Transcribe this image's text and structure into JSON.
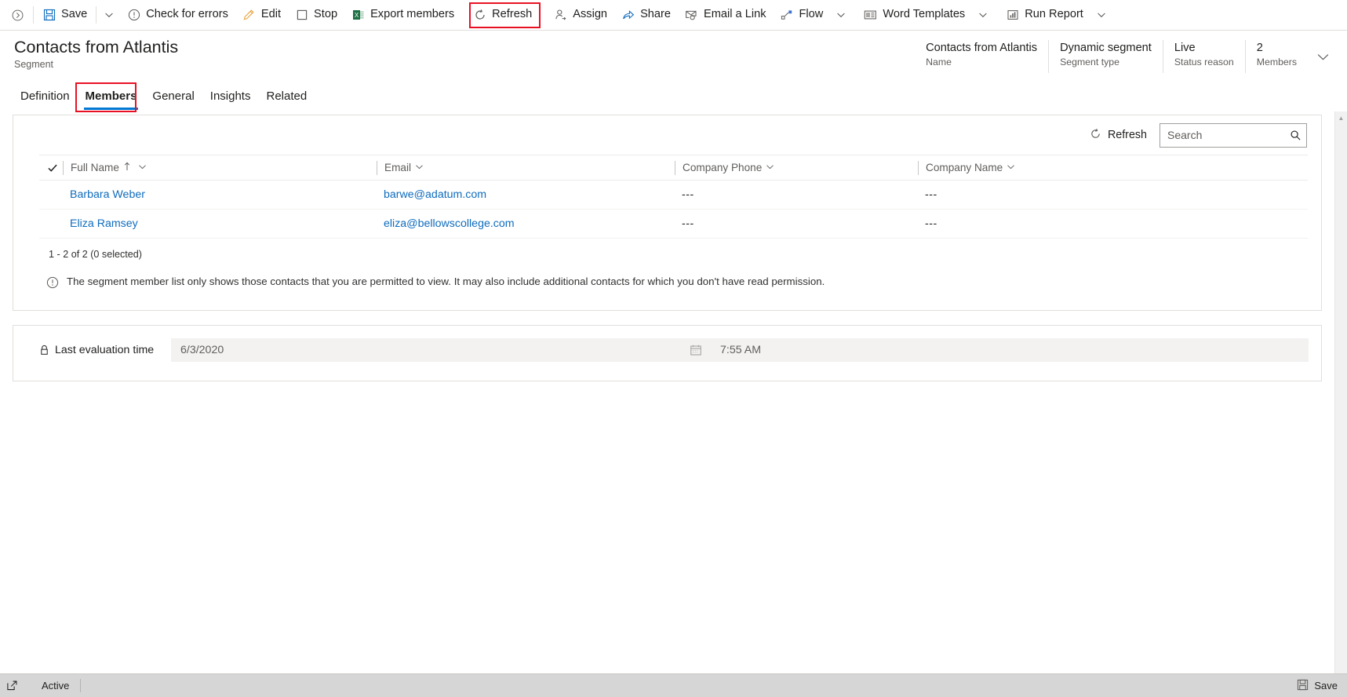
{
  "commandbar": {
    "expand_icon": "expand-right-icon",
    "buttons": [
      {
        "label": "Save",
        "icon": "save-icon",
        "chevron": true
      },
      {
        "label": "Check for errors",
        "icon": "error-circle-icon",
        "chevron": false
      },
      {
        "label": "Edit",
        "icon": "pencil-icon",
        "chevron": false
      },
      {
        "label": "Stop",
        "icon": "stop-square-icon",
        "chevron": false
      },
      {
        "label": "Export members",
        "icon": "excel-icon",
        "chevron": false
      },
      {
        "label": "Refresh",
        "icon": "refresh-icon",
        "chevron": false,
        "highlighted": true
      },
      {
        "label": "Assign",
        "icon": "assign-person-icon",
        "chevron": false
      },
      {
        "label": "Share",
        "icon": "share-icon",
        "chevron": false
      },
      {
        "label": "Email a Link",
        "icon": "email-link-icon",
        "chevron": false
      },
      {
        "label": "Flow",
        "icon": "flow-icon",
        "chevron": true
      },
      {
        "label": "Word Templates",
        "icon": "word-template-icon",
        "chevron": true
      },
      {
        "label": "Run Report",
        "icon": "run-report-icon",
        "chevron": true
      }
    ]
  },
  "header": {
    "title": "Contacts from Atlantis",
    "subtitle": "Segment",
    "fields": [
      {
        "value": "Contacts from Atlantis",
        "label": "Name"
      },
      {
        "value": "Dynamic segment",
        "label": "Segment type"
      },
      {
        "value": "Live",
        "label": "Status reason"
      },
      {
        "value": "2",
        "label": "Members"
      }
    ],
    "collapse_icon": "chevron-down-icon"
  },
  "tabs": [
    {
      "label": "Definition",
      "active": false
    },
    {
      "label": "Members",
      "active": true,
      "highlighted": true
    },
    {
      "label": "General",
      "active": false
    },
    {
      "label": "Insights",
      "active": false
    },
    {
      "label": "Related",
      "active": false
    }
  ],
  "grid": {
    "refresh_label": "Refresh",
    "refresh_icon": "refresh-icon",
    "search_placeholder": "Search",
    "search_value": "",
    "search_icon": "magnifier-icon",
    "select_all_icon": "checkmark-icon",
    "columns": [
      {
        "label": "Full Name",
        "sorted": true,
        "sort_icon": "sort-ascending-icon"
      },
      {
        "label": "Email",
        "sorted": false
      },
      {
        "label": "Company Phone",
        "sorted": false
      },
      {
        "label": "Company Name",
        "sorted": false
      }
    ],
    "rows": [
      {
        "full_name": "Barbara Weber",
        "email": "barwe@adatum.com",
        "company_phone": "---",
        "company_name": "---"
      },
      {
        "full_name": "Eliza Ramsey",
        "email": "eliza@bellowscollege.com",
        "company_phone": "---",
        "company_name": "---"
      }
    ],
    "footer_count": "1 - 2 of 2 (0 selected)",
    "notice_icon": "info-circle-icon",
    "notice": "The segment member list only shows those contacts that you are permitted to view. It may also include additional contacts for which you don't have read permission."
  },
  "evaluation": {
    "lock_icon": "lock-icon",
    "label": "Last evaluation time",
    "date_value": "6/3/2020",
    "calendar_icon": "calendar-icon",
    "time_value": "7:55 AM"
  },
  "footer": {
    "popout_icon": "popout-icon",
    "status": "Active",
    "save_label": "Save",
    "save_icon": "save-icon"
  },
  "colors": {
    "accent": "#0078d4",
    "link": "#0f6cbd",
    "highlight": "#e81123",
    "excel_green": "#1d7044"
  }
}
